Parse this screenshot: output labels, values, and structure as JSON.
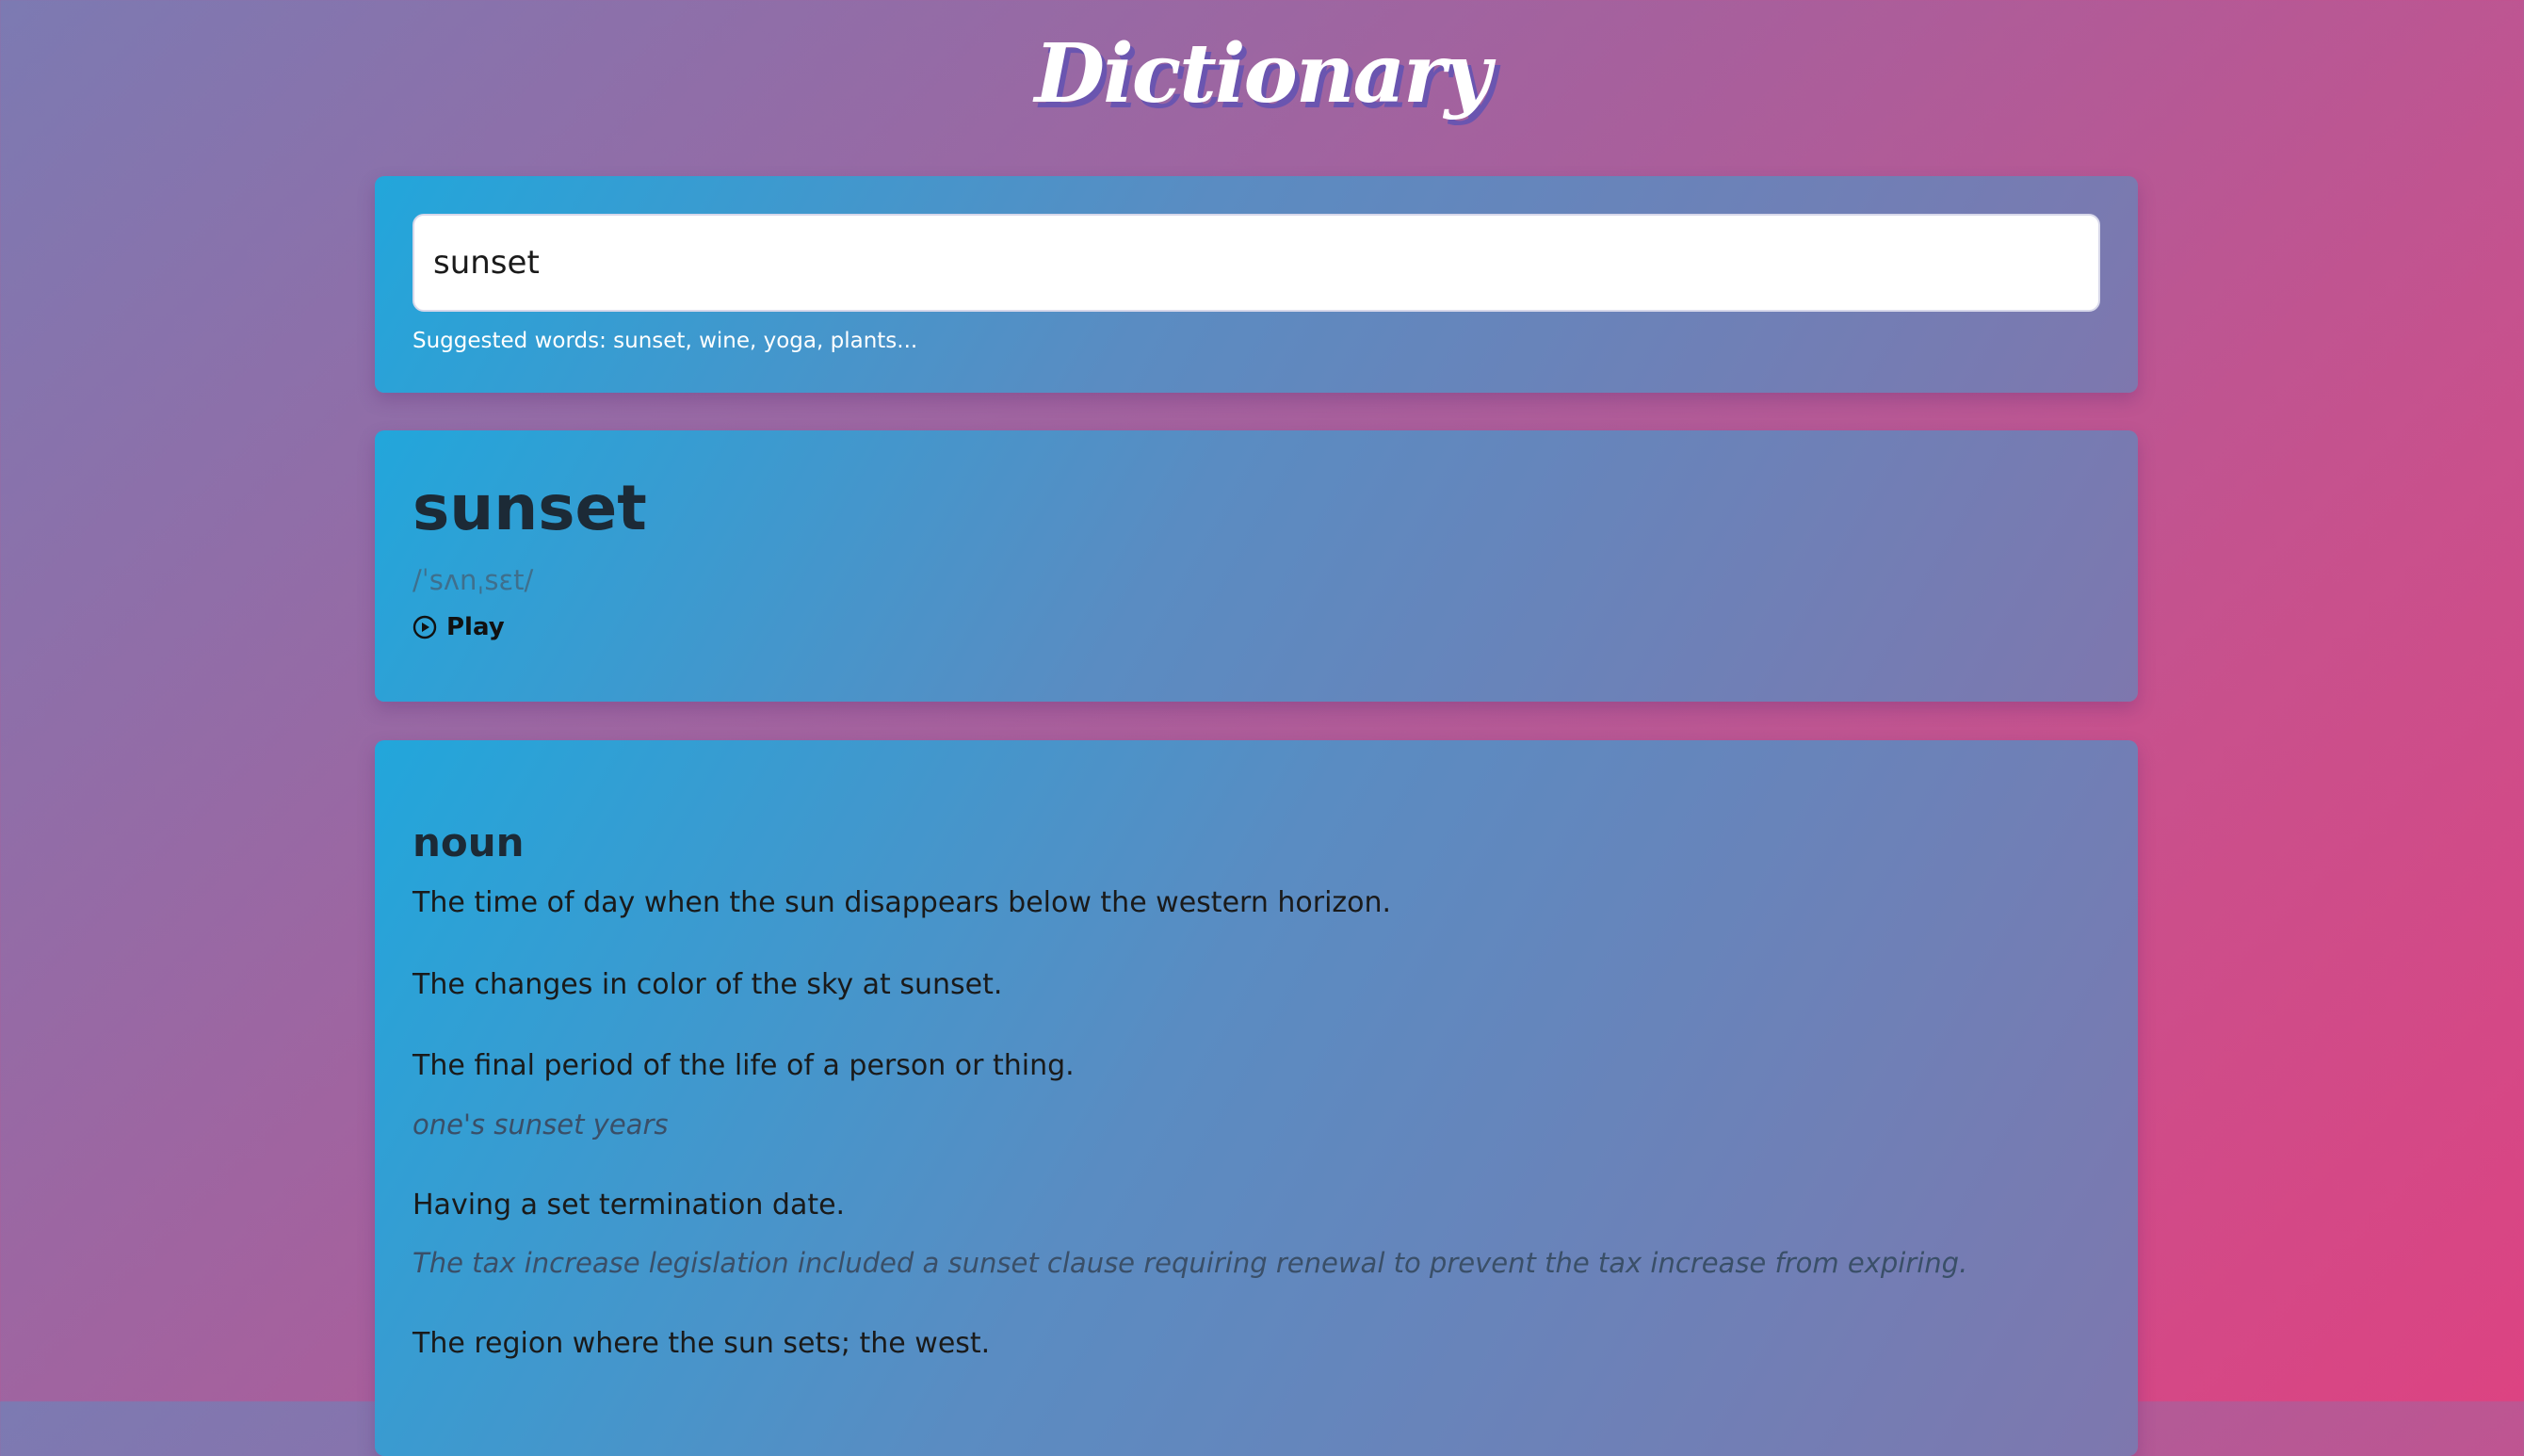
{
  "app": {
    "title": "Dictionary"
  },
  "search": {
    "value": "sunset",
    "hint": "Suggested words: sunset, wine, yoga, plants..."
  },
  "entry": {
    "word": "sunset",
    "phonetic": "/ˈsʌnˌsɛt/",
    "play_label": "Play"
  },
  "meaning": {
    "part_of_speech": "noun",
    "definitions": [
      {
        "text": "The time of day when the sun disappears below the western horizon.",
        "example": ""
      },
      {
        "text": "The changes in color of the sky at sunset.",
        "example": ""
      },
      {
        "text": "The final period of the life of a person or thing.",
        "example": "one's sunset years"
      },
      {
        "text": "Having a set termination date.",
        "example": "The tax increase legislation included a sunset clause requiring renewal to prevent the tax increase from expiring."
      },
      {
        "text": "The region where the sun sets; the west.",
        "example": ""
      }
    ]
  },
  "icons": {
    "play": "play-circle-icon"
  }
}
